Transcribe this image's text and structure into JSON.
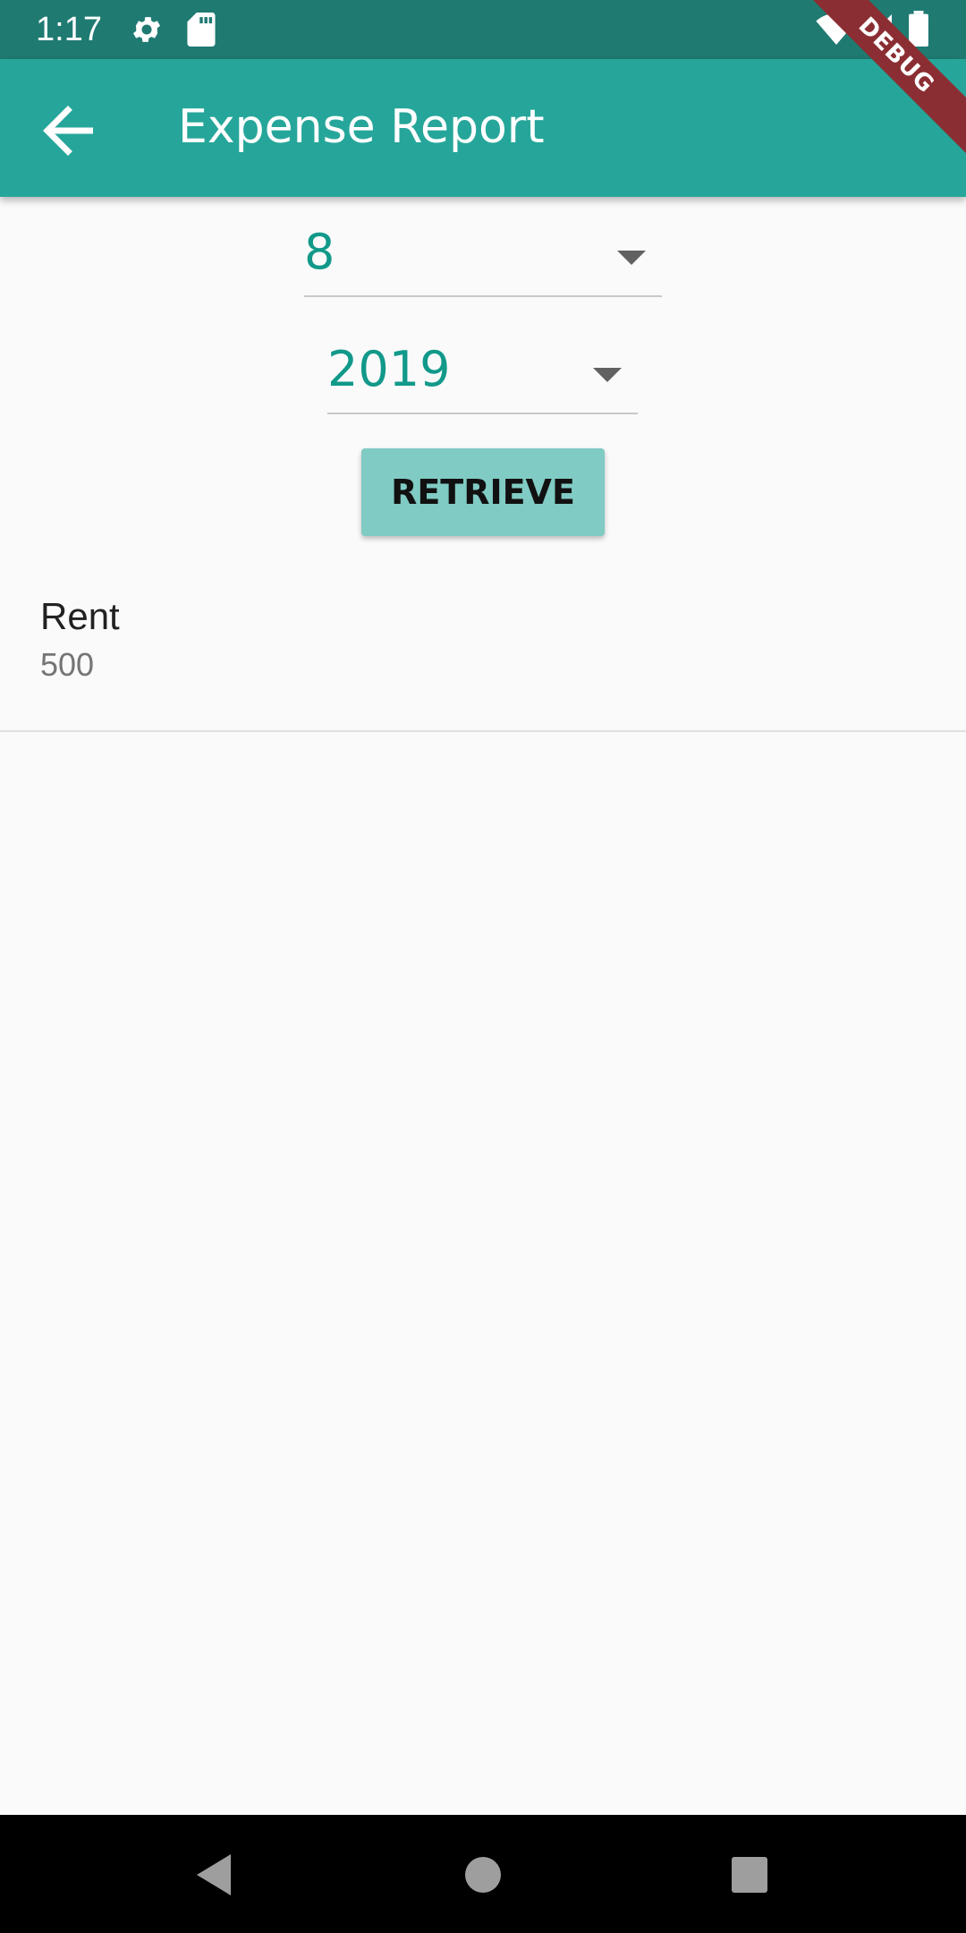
{
  "status_bar": {
    "time": "1:17",
    "icons": [
      "gear-icon",
      "sd-card-icon",
      "wifi-icon",
      "signal-icon",
      "battery-icon"
    ]
  },
  "app_bar": {
    "title": "Expense Report",
    "back_icon": "arrow-back-icon",
    "color": "#26A69A"
  },
  "debug_banner": {
    "label": "DEBUG"
  },
  "filters": {
    "month": {
      "value": "8"
    },
    "year": {
      "value": "2019"
    },
    "retrieve_label": "RETRIEVE"
  },
  "expenses": [
    {
      "name": "Rent",
      "amount": "500"
    }
  ],
  "colors": {
    "accent": "#26A69A",
    "status_bar": "#1F7A72",
    "dropdown_text": "#11998A",
    "button": "#80CBC4"
  },
  "nav_bar": {
    "icons": [
      "back-triangle-icon",
      "home-circle-icon",
      "recents-square-icon"
    ]
  }
}
